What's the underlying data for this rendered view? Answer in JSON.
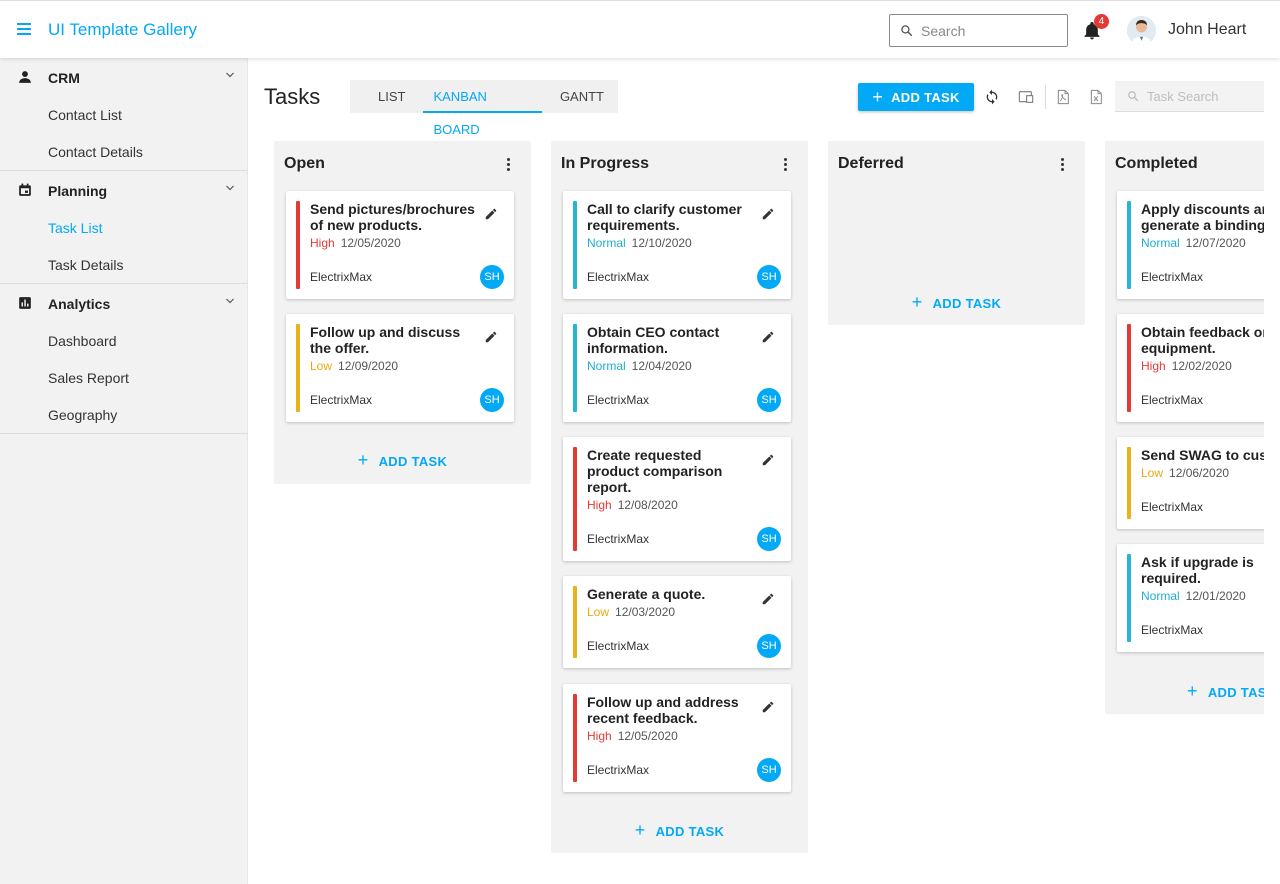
{
  "app": {
    "title": "UI Template Gallery"
  },
  "header": {
    "search_placeholder": "Search",
    "notifications_count": "4",
    "user_name": "John Heart"
  },
  "sidebar": {
    "groups": [
      {
        "label": "CRM",
        "icon": "person-icon",
        "items": [
          "Contact List",
          "Contact Details"
        ]
      },
      {
        "label": "Planning",
        "icon": "calendar-icon",
        "items": [
          "Task List",
          "Task Details"
        ]
      },
      {
        "label": "Analytics",
        "icon": "bar-chart-icon",
        "items": [
          "Dashboard",
          "Sales Report",
          "Geography"
        ]
      }
    ],
    "active_item": "Task List"
  },
  "page": {
    "title": "Tasks",
    "tabs": [
      "LIST",
      "KANBAN BOARD",
      "GANTT"
    ],
    "active_tab": "KANBAN BOARD",
    "add_task_label": "ADD TASK",
    "task_search_placeholder": "Task Search"
  },
  "colors": {
    "accent": "#03a9f4",
    "high": "#e53935",
    "normal": "#26b6d0",
    "low": "#e8b218"
  },
  "board": {
    "add_task_label": "ADD TASK",
    "columns": [
      {
        "title": "Open",
        "cards": [
          {
            "title": "Send pictures/brochures of new products.",
            "priority": "High",
            "date": "12/05/2020",
            "company": "ElectrixMax",
            "assignee": "SH"
          },
          {
            "title": "Follow up and discuss the offer.",
            "priority": "Low",
            "date": "12/09/2020",
            "company": "ElectrixMax",
            "assignee": "SH"
          }
        ]
      },
      {
        "title": "In Progress",
        "cards": [
          {
            "title": "Call to clarify customer requirements.",
            "priority": "Normal",
            "date": "12/10/2020",
            "company": "ElectrixMax",
            "assignee": "SH"
          },
          {
            "title": "Obtain CEO contact information.",
            "priority": "Normal",
            "date": "12/04/2020",
            "company": "ElectrixMax",
            "assignee": "SH"
          },
          {
            "title": "Create requested product comparison report.",
            "priority": "High",
            "date": "12/08/2020",
            "company": "ElectrixMax",
            "assignee": "SH"
          },
          {
            "title": "Generate a quote.",
            "priority": "Low",
            "date": "12/03/2020",
            "company": "ElectrixMax",
            "assignee": "SH"
          },
          {
            "title": "Follow up and address recent feedback.",
            "priority": "High",
            "date": "12/05/2020",
            "company": "ElectrixMax",
            "assignee": "SH"
          }
        ]
      },
      {
        "title": "Deferred",
        "cards": []
      },
      {
        "title": "Completed",
        "cards": [
          {
            "title": "Apply discounts and generate a binding offer.",
            "priority": "Normal",
            "date": "12/07/2020",
            "company": "ElectrixMax",
            "assignee": ""
          },
          {
            "title": "Obtain feedback on equipment.",
            "priority": "High",
            "date": "12/02/2020",
            "company": "ElectrixMax",
            "assignee": ""
          },
          {
            "title": "Send SWAG to customer.",
            "priority": "Low",
            "date": "12/06/2020",
            "company": "ElectrixMax",
            "assignee": ""
          },
          {
            "title": "Ask if upgrade is required.",
            "priority": "Normal",
            "date": "12/01/2020",
            "company": "ElectrixMax",
            "assignee": ""
          }
        ]
      }
    ]
  }
}
